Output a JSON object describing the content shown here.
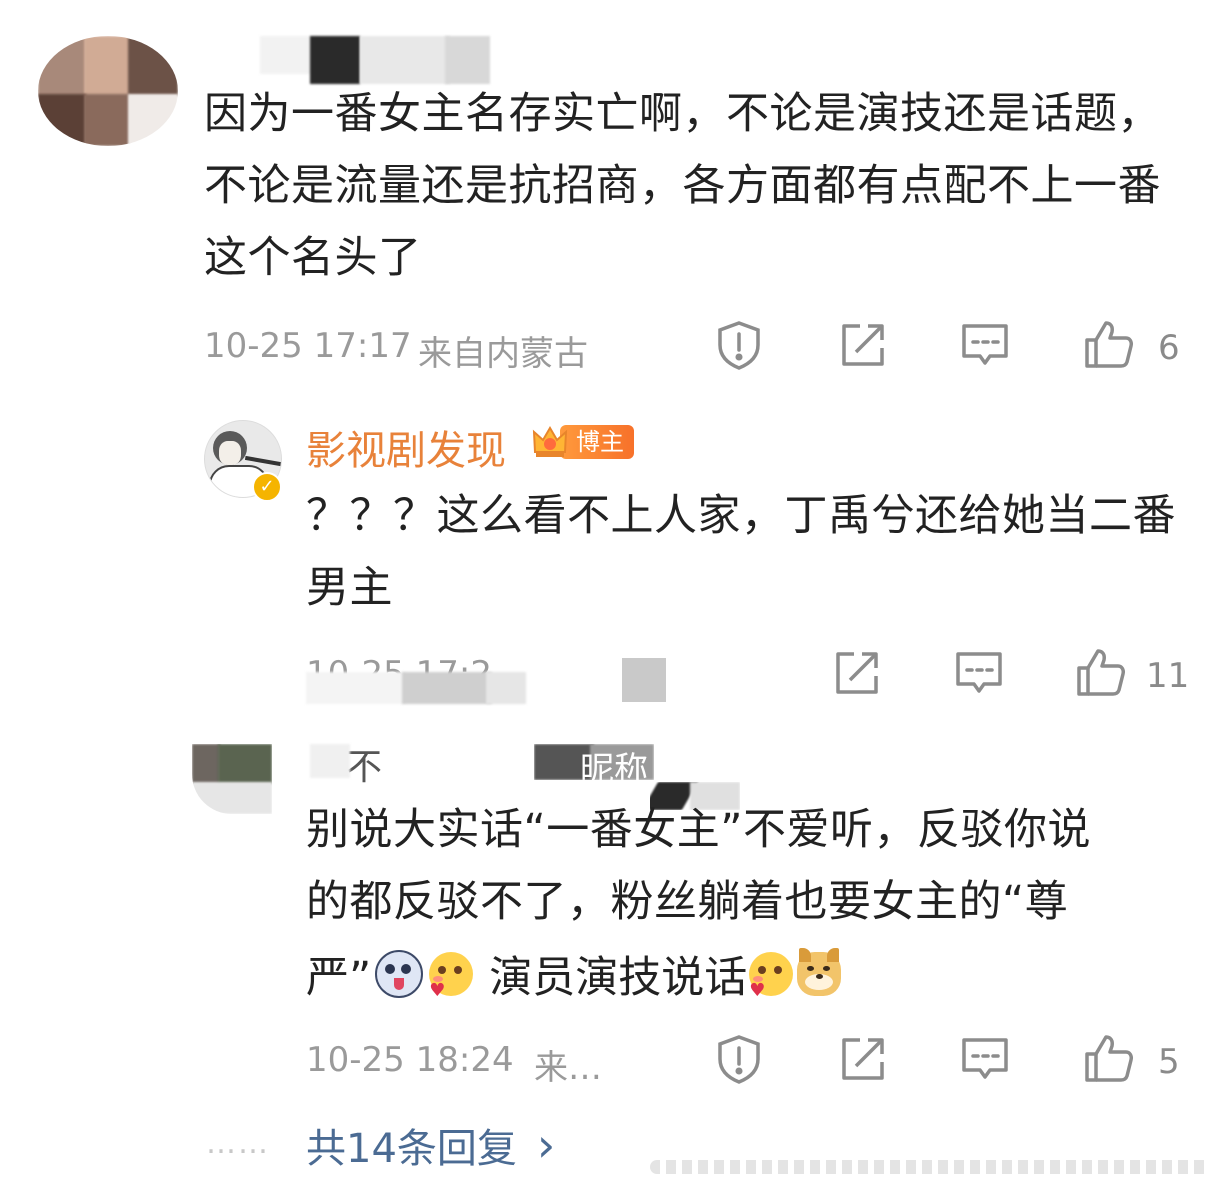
{
  "comment1": {
    "text": "因为一番女主名存实亡啊，不论是演技还是话题，不论是流量还是抗招商，各方面都有点配不上一番这个名头了",
    "time": "10-25 17:17",
    "location": "来自内蒙古",
    "like_count": "6",
    "icons": [
      "report-icon",
      "share-icon",
      "comment-icon",
      "like-icon"
    ]
  },
  "reply1": {
    "username": "影视剧发现",
    "badge": "博主",
    "text": "？？？这么看不上人家，丁禹兮还给她当二番男主",
    "time": "10-25 17:2",
    "like_count": "11",
    "icons": [
      "share-icon",
      "comment-icon",
      "like-icon"
    ]
  },
  "reply2": {
    "username_fragment_a": "不",
    "username_fragment_b": "昵称",
    "text_line1": "别说大实话“一番女主”不爱听，反驳你说",
    "text_line2": "的都反驳不了，粉丝躺着也要女主的“尊",
    "text_part3a": "严”",
    "text_part3b": "演员演技说话",
    "time": "10-25 18:24",
    "location": "来…",
    "like_count": "5",
    "icons": [
      "report-icon",
      "share-icon",
      "comment-icon",
      "like-icon"
    ]
  },
  "footer": {
    "dots": "……",
    "more_replies": "共14条回复",
    "chevron": "›"
  },
  "colors": {
    "username": "#e8823a",
    "link": "#4b6b93",
    "meta": "#9a9a9a",
    "text": "#222222"
  }
}
